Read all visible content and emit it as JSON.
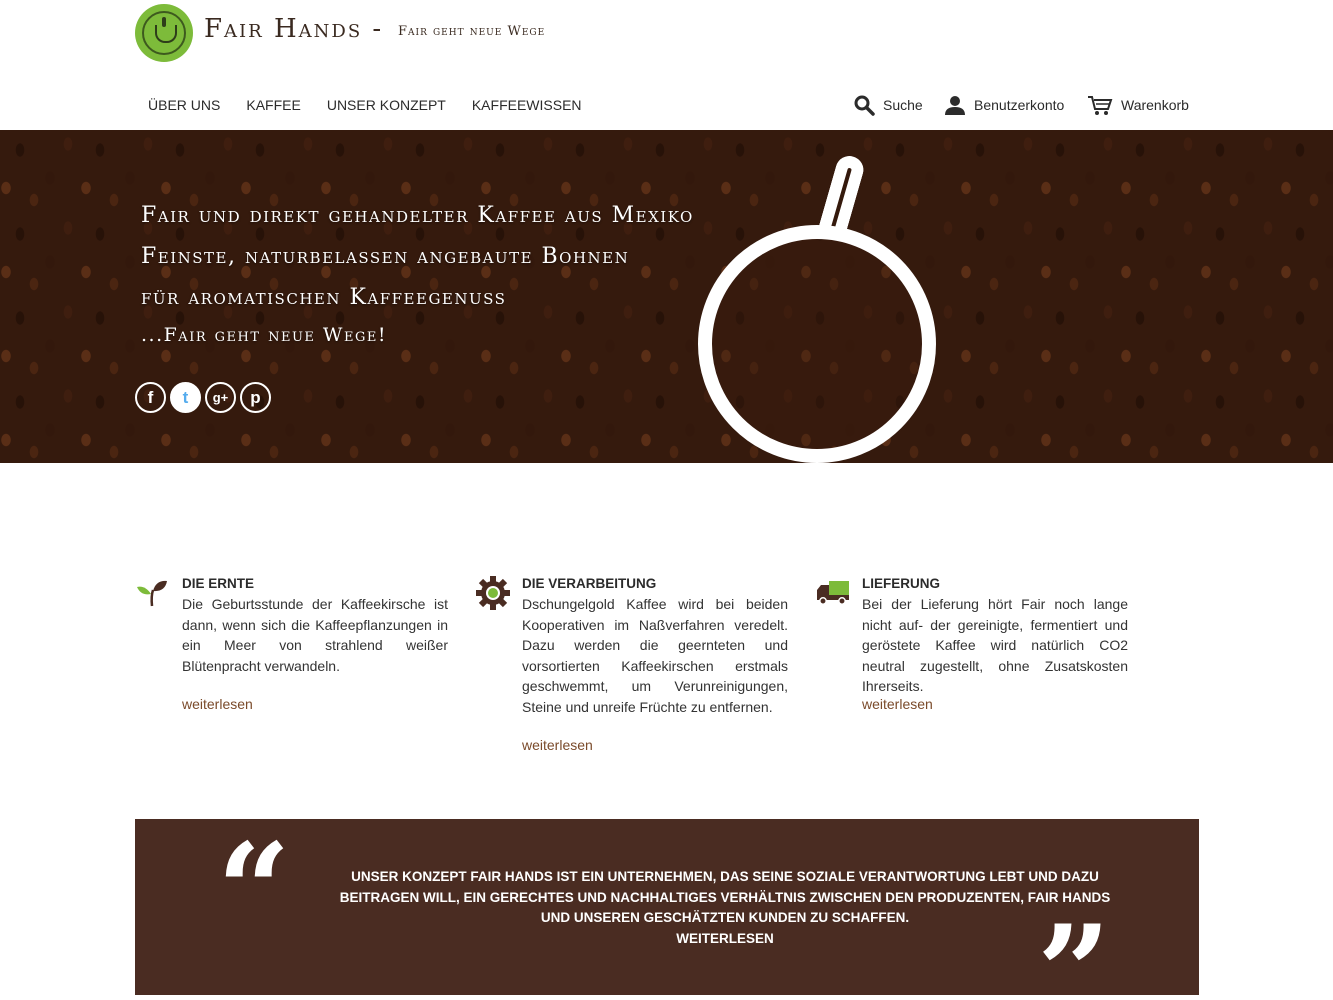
{
  "header": {
    "brand": "Fair Hands -",
    "tagline": "Fair geht neue Wege",
    "nav": [
      "ÜBER UNS",
      "KAFFEE",
      "UNSER KONZEPT",
      "KAFFEEWISSEN"
    ],
    "search_label": "Suche",
    "account_label": "Benutzerkonto",
    "cart_label": "Warenkorb"
  },
  "hero": {
    "lines": [
      "Fair und direkt gehandelter Kaffee aus Mexiko",
      "Feinste, naturbelassen angebaute Bohnen",
      "für aromatischen Kaffeegenuss",
      "...Fair geht neue Wege!"
    ],
    "socials": [
      "f",
      "t",
      "g+",
      "p"
    ]
  },
  "features": [
    {
      "title": "DIE ERNTE",
      "text": "Die Geburtsstunde der Kaffeekirsche ist dann, wenn sich die Kaffeepflanzungen in ein Meer von strahlend weißer Blütenpracht verwandeln.",
      "link": "weiterlesen"
    },
    {
      "title": "DIE VERARBEITUNG",
      "text": "Dschungelgold Kaffee wird bei beiden Kooperativen im Naßverfahren veredelt. Dazu werden die geernteten und vorsortierten Kaffeekirschen erstmals geschwemmt, um Verunreinigungen, Steine und unreife Früchte zu entfernen.",
      "link": "weiterlesen"
    },
    {
      "title": "LIEFERUNG",
      "text": "Bei der Lieferung hört Fair noch lange nicht auf- der gereinigte, fermentiert und geröstete Kaffee wird natürlich CO2 neutral zugestellt, ohne Zusatskosten Ihrerseits.",
      "link": "weiterlesen"
    }
  ],
  "quote": {
    "text": "Unser Konzept Fair Hands ist ein Unternehmen, das seine soziale Verantwortung lebt und dazu beitragen will, ein gerechtes und nachhaltiges Verhältnis zwischen den Produzenten, Fair Hands und unseren geschätzten Kunden zu schaffen.",
    "link": "WEITERLESEN"
  },
  "colors": {
    "accent_green": "#7dbb3a",
    "brown": "#4a2c22",
    "link_brown": "#7a4a2a"
  }
}
